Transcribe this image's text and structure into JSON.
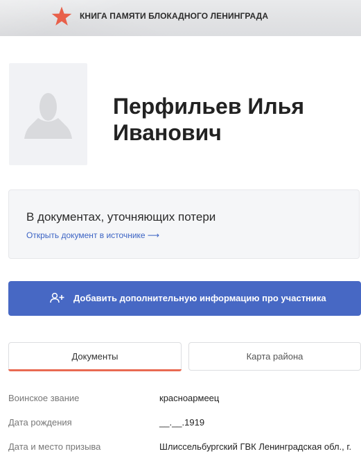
{
  "header": {
    "title": "КНИГА ПАМЯТИ БЛОКАДНОГО ЛЕНИНГРАДА",
    "star_color": "#e8604a",
    "star_icon": "star-icon"
  },
  "profile": {
    "full_name": "Перфильев Илья Иванович",
    "avatar_icon": "person-silhouette-icon"
  },
  "info_box": {
    "text": "В документах, уточняющих потери",
    "link_label": "Открыть документ в источнике ⟶"
  },
  "actions": {
    "add_info_label": "Добавить дополнительную информацию про участника",
    "add_info_icon": "add-user-icon",
    "button_color": "#4768c4"
  },
  "tabs": [
    {
      "label": "Документы",
      "active": true
    },
    {
      "label": "Карта района",
      "active": false
    }
  ],
  "details": [
    {
      "label": "Воинское звание",
      "value": "красноармеец"
    },
    {
      "label": "Дата рождения",
      "value": "__.__.1919"
    },
    {
      "label": "Дата и место призыва",
      "value": "Шлиссельбургский ГВК Ленинградская обл., г."
    }
  ],
  "colors": {
    "accent": "#e96a52",
    "link": "#3b63c4"
  }
}
